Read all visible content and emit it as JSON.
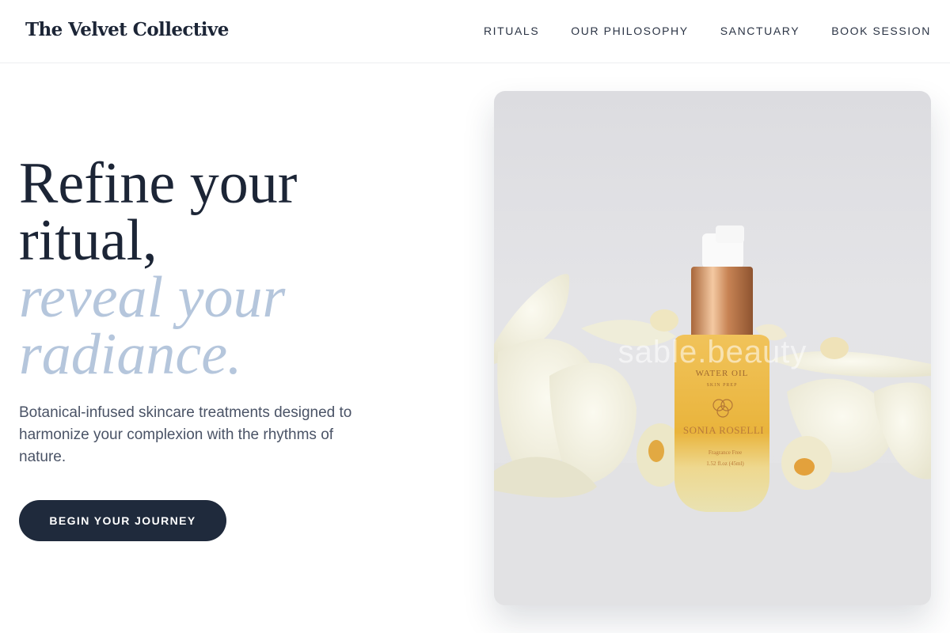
{
  "header": {
    "brand": "The Velvet Collective",
    "nav": [
      "RITUALS",
      "OUR PHILOSOPHY",
      "SANCTUARY",
      "BOOK SESSION"
    ]
  },
  "hero": {
    "headline_line1": "Refine your",
    "headline_line2": "ritual,",
    "headline_accent_line1": "reveal your",
    "headline_accent_line2": "radiance.",
    "lead": "Botanical-infused skincare treatments designed to harmonize your complexion with the rhythms of nature.",
    "cta_label": "BEGIN YOUR JOURNEY"
  },
  "product_image": {
    "watermark": "sable.beauty",
    "bottle_label_title": "WATER OIL",
    "bottle_label_sub": "SKIN PREP",
    "bottle_brand": "SONIA ROSELLI",
    "bottle_note": "Fragrance Free",
    "bottle_volume": "1.52 fl.oz (45ml)"
  },
  "colors": {
    "primary": "#1f2a3c",
    "accent_text": "#b5c6dc",
    "body_text": "#4a5366"
  }
}
